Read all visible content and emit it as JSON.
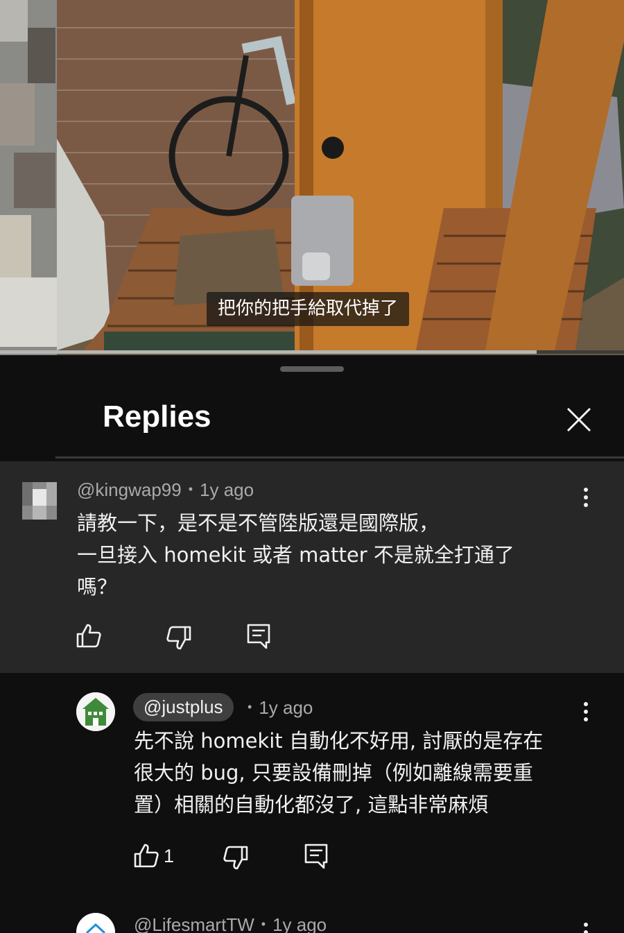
{
  "video": {
    "caption": "把你的把手給取代掉了",
    "progress_fraction": 0.86
  },
  "sheet": {
    "title": "Replies"
  },
  "parent_comment": {
    "handle": "@kingwap99",
    "age": "1y ago",
    "lines": [
      "請教一下，是不是不管陸版還是國際版，",
      "一旦接入 homekit  或者 matter 不是就全打通了",
      "嗎？"
    ]
  },
  "replies": [
    {
      "handle": "@justplus",
      "age": "1y ago",
      "lines": [
        "先不說 homekit 自動化不好用, 討厭的是存在",
        "很大的 bug, 只要設備刪掉（例如離線需要重",
        "置）相關的自動化都沒了, 這點非常麻煩"
      ],
      "likes": "1"
    },
    {
      "handle": "@LifesmartTW",
      "age": "1y ago"
    }
  ],
  "separator": "•",
  "colors": {
    "background": "#0f0f0f",
    "highlight": "#272727",
    "text": "#f1f1f1",
    "secondary_text": "#aaaaaa"
  }
}
